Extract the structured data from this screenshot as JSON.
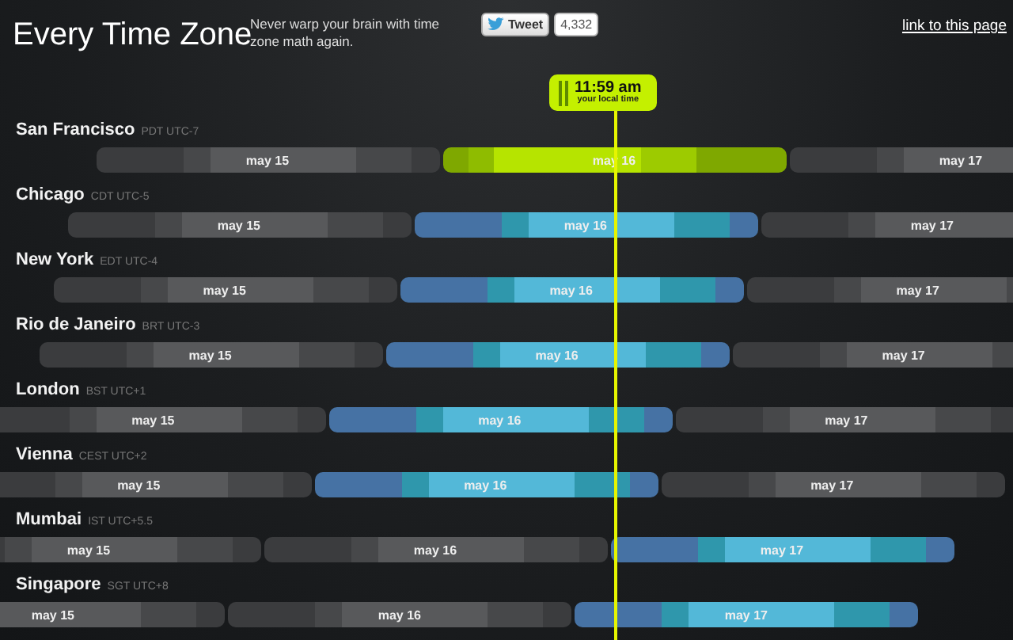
{
  "header": {
    "title": "Every Time Zone",
    "tagline": "Never warp your brain with time zone math again.",
    "tweet_button": "Tweet",
    "tweet_count": "4,332",
    "link": "link to this page"
  },
  "now": {
    "time": "11:59 am",
    "caption": "your local time"
  },
  "rows": [
    {
      "city": "San Francisco",
      "zone": "PDT UTC-7",
      "days": [
        {
          "label": "may 15",
          "kind": "other"
        },
        {
          "label": "may 16",
          "kind": "local"
        },
        {
          "label": "may 17",
          "kind": "other"
        }
      ]
    },
    {
      "city": "Chicago",
      "zone": "CDT UTC-5",
      "days": [
        {
          "label": "may 15",
          "kind": "other"
        },
        {
          "label": "may 16",
          "kind": "current"
        },
        {
          "label": "may 17",
          "kind": "other"
        }
      ]
    },
    {
      "city": "New York",
      "zone": "EDT UTC-4",
      "days": [
        {
          "label": "may 15",
          "kind": "other"
        },
        {
          "label": "may 16",
          "kind": "current"
        },
        {
          "label": "may 17",
          "kind": "other"
        }
      ]
    },
    {
      "city": "Rio de Janeiro",
      "zone": "BRT UTC-3",
      "days": [
        {
          "label": "may 15",
          "kind": "other"
        },
        {
          "label": "may 16",
          "kind": "current"
        },
        {
          "label": "may 17",
          "kind": "other"
        }
      ]
    },
    {
      "city": "London",
      "zone": "BST UTC+1",
      "days": [
        {
          "label": "may 15",
          "kind": "other"
        },
        {
          "label": "may 16",
          "kind": "current"
        },
        {
          "label": "may 17",
          "kind": "other"
        }
      ]
    },
    {
      "city": "Vienna",
      "zone": "CEST UTC+2",
      "days": [
        {
          "label": "may 15",
          "kind": "other"
        },
        {
          "label": "may 16",
          "kind": "current"
        },
        {
          "label": "may 17",
          "kind": "other"
        }
      ]
    },
    {
      "city": "Mumbai",
      "zone": "IST UTC+5.5",
      "days": [
        {
          "label": "may 15",
          "kind": "other"
        },
        {
          "label": "may 16",
          "kind": "other"
        },
        {
          "label": "may 17",
          "kind": "current"
        }
      ]
    },
    {
      "city": "Singapore",
      "zone": "SGT UTC+8",
      "days": [
        {
          "label": "may 15",
          "kind": "other"
        },
        {
          "label": "may 16",
          "kind": "other"
        },
        {
          "label": "may 17",
          "kind": "current"
        }
      ]
    }
  ]
}
